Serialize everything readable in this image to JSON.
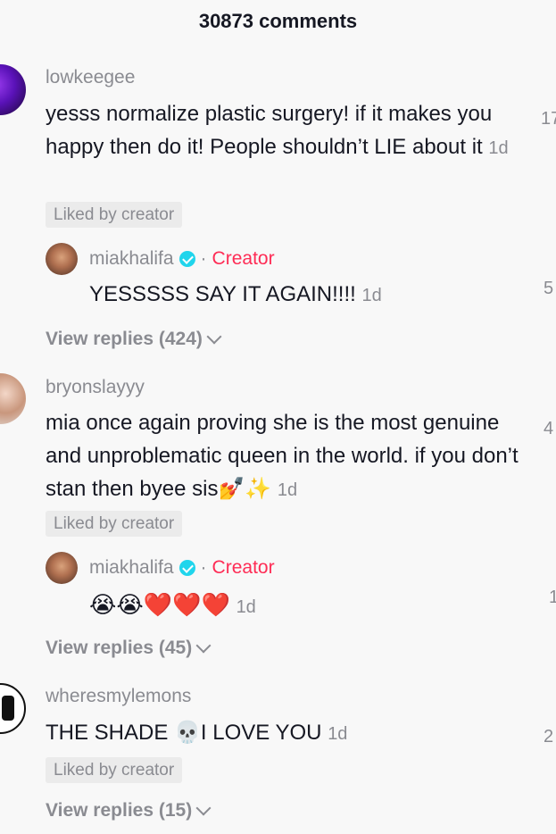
{
  "header": {
    "title": "30873 comments"
  },
  "comments": [
    {
      "username": "lowkeegee",
      "text": "yesss normalize plastic surgery! if it makes you happy then do it! People shouldn’t LIE about it",
      "time": "1d",
      "liked_badge": "Liked by creator",
      "like_count": "17",
      "reply": {
        "username": "miakhalifa",
        "creator_label": "Creator",
        "text": "YESSSSS SAY IT AGAIN!!!!",
        "time": "1d",
        "like_count": "5"
      },
      "view_replies": "View replies (424)"
    },
    {
      "username": "bryonslayyy",
      "text": "mia once again proving she is the most genuine and unproblematic queen in the world. if you don’t stan then byee sis💅✨",
      "time": "1d",
      "liked_badge": "Liked by creator",
      "like_count": "4",
      "reply": {
        "username": "miakhalifa",
        "creator_label": "Creator",
        "text": "😭😭❤️❤️❤️",
        "time": "1d",
        "like_count": "1"
      },
      "view_replies": "View replies (45)"
    },
    {
      "username": "wheresmylemons",
      "text": "THE SHADE 💀I LOVE YOU",
      "time": "1d",
      "liked_badge": "Liked by creator",
      "like_count": "2",
      "view_replies": "View replies (15)"
    }
  ]
}
